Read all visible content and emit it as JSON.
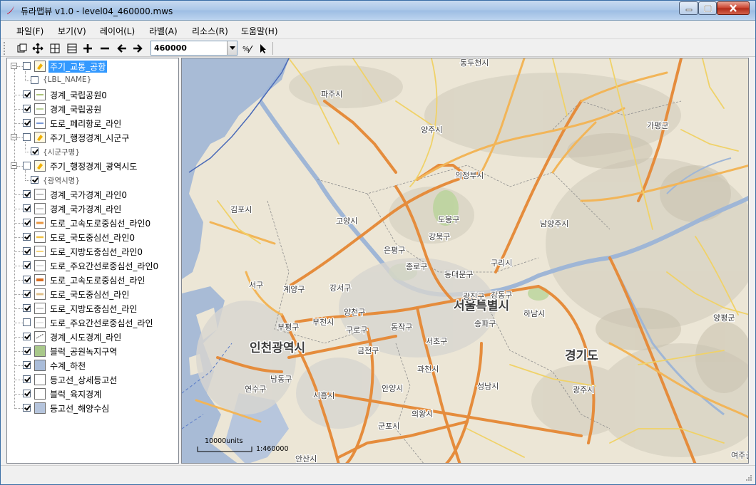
{
  "window": {
    "title": "듀라맵뷰 v1.0 - level04_460000.mws",
    "controls": {
      "minimize": "minimize",
      "maximize": "maximize",
      "close": "close"
    }
  },
  "menu": [
    {
      "label": "파일(F)"
    },
    {
      "label": "보기(V)"
    },
    {
      "label": "레이어(L)"
    },
    {
      "label": "라벨(A)"
    },
    {
      "label": "리소스(R)"
    },
    {
      "label": "도움말(H)"
    }
  ],
  "toolbar": {
    "scale_value": "460000",
    "tools": [
      "zoom-extent-icon",
      "pan-icon",
      "zoom-window-icon",
      "zoom-box-icon",
      "zoom-in-icon",
      "zoom-out-icon",
      "back-icon",
      "forward-icon",
      "scale-ratio-icon",
      "pointer-icon"
    ]
  },
  "layers": [
    {
      "label": "주기_교통_공항",
      "kind": "group",
      "checked": false,
      "selected": true
    },
    {
      "label": "{LBL_NAME}",
      "kind": "sub",
      "checked": false
    },
    {
      "label": "경계_국립공원0",
      "kind": "layer",
      "checked": true
    },
    {
      "label": "경계_국립공원",
      "kind": "layer",
      "checked": true
    },
    {
      "label": "도로_페리항로_라인",
      "kind": "layer",
      "checked": true
    },
    {
      "label": "주기_행정경계_시군구",
      "kind": "group",
      "checked": false
    },
    {
      "label": "{시군구명}",
      "kind": "sub",
      "checked": true
    },
    {
      "label": "주기_행정경계_광역시도",
      "kind": "group",
      "checked": false
    },
    {
      "label": "{광역시명}",
      "kind": "sub",
      "checked": true
    },
    {
      "label": "경계_국가경계_라인0",
      "kind": "layer",
      "checked": true
    },
    {
      "label": "경계_국가경계_라인",
      "kind": "layer",
      "checked": true
    },
    {
      "label": "도로_고속도로중심선_라인0",
      "kind": "layer",
      "checked": true
    },
    {
      "label": "도로_국도중심선_라인0",
      "kind": "layer",
      "checked": true
    },
    {
      "label": "도로_지방도중심선_라인0",
      "kind": "layer",
      "checked": true
    },
    {
      "label": "도로_주요간선로중심선_라인0",
      "kind": "layer",
      "checked": true
    },
    {
      "label": "도로_고속도로중심선_라인",
      "kind": "layer",
      "checked": true
    },
    {
      "label": "도로_국도중심선_라인",
      "kind": "layer",
      "checked": true
    },
    {
      "label": "도로_지방도중심선_라인",
      "kind": "layer",
      "checked": true
    },
    {
      "label": "도로_주요간선로중심선_라인",
      "kind": "layer",
      "checked": false
    },
    {
      "label": "경계_시도경계_라인",
      "kind": "layer",
      "checked": true
    },
    {
      "label": "블럭_공원녹지구역",
      "kind": "layer",
      "checked": true
    },
    {
      "label": "수계_하천",
      "kind": "layer",
      "checked": true
    },
    {
      "label": "등고선_상세등고선",
      "kind": "layer",
      "checked": true
    },
    {
      "label": "블럭_육지경계",
      "kind": "layer",
      "checked": true
    },
    {
      "label": "등고선_해양수심",
      "kind": "layer",
      "checked": true
    }
  ],
  "map": {
    "labels": [
      {
        "text": "동두천시",
        "size": "small"
      },
      {
        "text": "파주시",
        "size": "small"
      },
      {
        "text": "양주시",
        "size": "small"
      },
      {
        "text": "가평군",
        "size": "small"
      },
      {
        "text": "의정부시",
        "size": "small"
      },
      {
        "text": "김포시",
        "size": "small"
      },
      {
        "text": "고양시",
        "size": "small"
      },
      {
        "text": "도봉구",
        "size": "small"
      },
      {
        "text": "강북구",
        "size": "small"
      },
      {
        "text": "남양주시",
        "size": "small"
      },
      {
        "text": "은평구",
        "size": "small"
      },
      {
        "text": "종로구",
        "size": "small"
      },
      {
        "text": "구리시",
        "size": "small"
      },
      {
        "text": "동대문구",
        "size": "small"
      },
      {
        "text": "서구",
        "size": "small"
      },
      {
        "text": "계양구",
        "size": "small"
      },
      {
        "text": "강서구",
        "size": "small"
      },
      {
        "text": "서울특별시",
        "size": "large"
      },
      {
        "text": "광진구",
        "size": "small"
      },
      {
        "text": "강동구",
        "size": "small"
      },
      {
        "text": "양천구",
        "size": "small"
      },
      {
        "text": "하남시",
        "size": "small"
      },
      {
        "text": "부평구",
        "size": "small"
      },
      {
        "text": "부천시",
        "size": "small"
      },
      {
        "text": "구로구",
        "size": "small"
      },
      {
        "text": "동작구",
        "size": "small"
      },
      {
        "text": "송파구",
        "size": "small"
      },
      {
        "text": "양평군",
        "size": "small"
      },
      {
        "text": "인천광역시",
        "size": "large"
      },
      {
        "text": "서초구",
        "size": "small"
      },
      {
        "text": "금천구",
        "size": "small"
      },
      {
        "text": "경기도",
        "size": "large"
      },
      {
        "text": "과천시",
        "size": "small"
      },
      {
        "text": "남동구",
        "size": "small"
      },
      {
        "text": "연수구",
        "size": "small"
      },
      {
        "text": "성남시",
        "size": "small"
      },
      {
        "text": "안양시",
        "size": "small"
      },
      {
        "text": "광주시",
        "size": "small"
      },
      {
        "text": "시흥시",
        "size": "small"
      },
      {
        "text": "의왕시",
        "size": "small"
      },
      {
        "text": "군포시",
        "size": "small"
      },
      {
        "text": "안산시",
        "size": "small"
      },
      {
        "text": "여주군",
        "size": "small"
      }
    ],
    "scale_bar": {
      "units_label": "10000units",
      "ratio_label": "1:460000"
    }
  },
  "status": {
    "text": ""
  }
}
